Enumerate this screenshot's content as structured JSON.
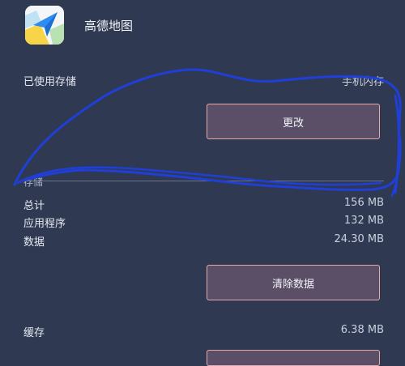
{
  "app": {
    "name": "高德地图",
    "icon": "amap-logo-icon"
  },
  "storage_used": {
    "label": "已使用存储",
    "value": "手机内存",
    "change_button": "更改"
  },
  "storage": {
    "section_label": "存储",
    "rows": [
      {
        "label": "总计",
        "value": "156 MB"
      },
      {
        "label": "应用程序",
        "value": "132 MB"
      },
      {
        "label": "数据",
        "value": "24.30 MB"
      }
    ],
    "clear_data_button": "清除数据"
  },
  "cache": {
    "label": "缓存",
    "value": "6.38 MB"
  },
  "colors": {
    "background": "#2f3a52",
    "button_fill": "#5a4f66",
    "button_border": "#e9a9a9",
    "scribble": "#1f3fd6"
  }
}
